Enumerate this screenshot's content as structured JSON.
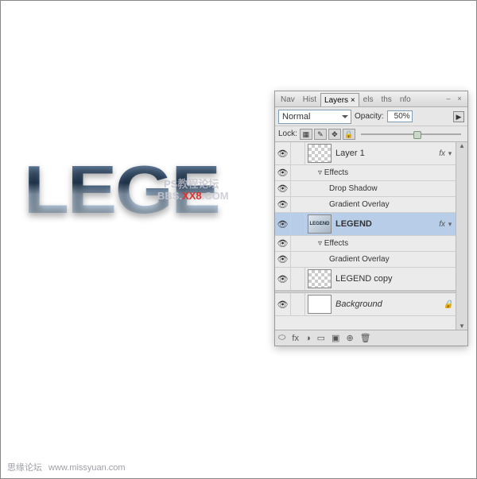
{
  "canvas": {
    "logo_text": "LEGE",
    "watermark1": "PS教程论坛",
    "watermark2_a": "BBS.",
    "watermark2_b": "XX8",
    "watermark2_c": ".COM"
  },
  "footer": {
    "site": "思缘论坛",
    "url": "www.missyuan.com"
  },
  "panel": {
    "tabs": [
      "Nav",
      "Hist",
      "Layers",
      "els",
      "ths",
      "nfo"
    ],
    "active_tab_index": 2,
    "blend_mode": "Normal",
    "opacity_label": "Opacity:",
    "opacity_value": "50%",
    "opacity_slider_percent": 50,
    "lock_label": "Lock:",
    "lock_icons": [
      "▦",
      "✎",
      "✥",
      "🔒"
    ]
  },
  "layers": [
    {
      "name": "Layer 1",
      "visible": true,
      "hasFx": true,
      "expanded": true,
      "thumb": "checker",
      "effects_label": "Effects",
      "effects": [
        "Drop Shadow",
        "Gradient Overlay"
      ]
    },
    {
      "name": "LEGEND",
      "visible": true,
      "hasFx": true,
      "expanded": true,
      "selected": true,
      "thumb": "legend",
      "effects_label": "Effects",
      "effects": [
        "Gradient Overlay"
      ]
    },
    {
      "name": "LEGEND copy",
      "visible": true,
      "hasFx": false,
      "thumb": "checker"
    },
    {
      "name": "Background",
      "visible": true,
      "italic": true,
      "locked": true,
      "thumb": "white"
    }
  ],
  "bottom_icons": [
    "⬭",
    "fx",
    "◑",
    "▭",
    "▣",
    "⊕",
    "🗑"
  ]
}
